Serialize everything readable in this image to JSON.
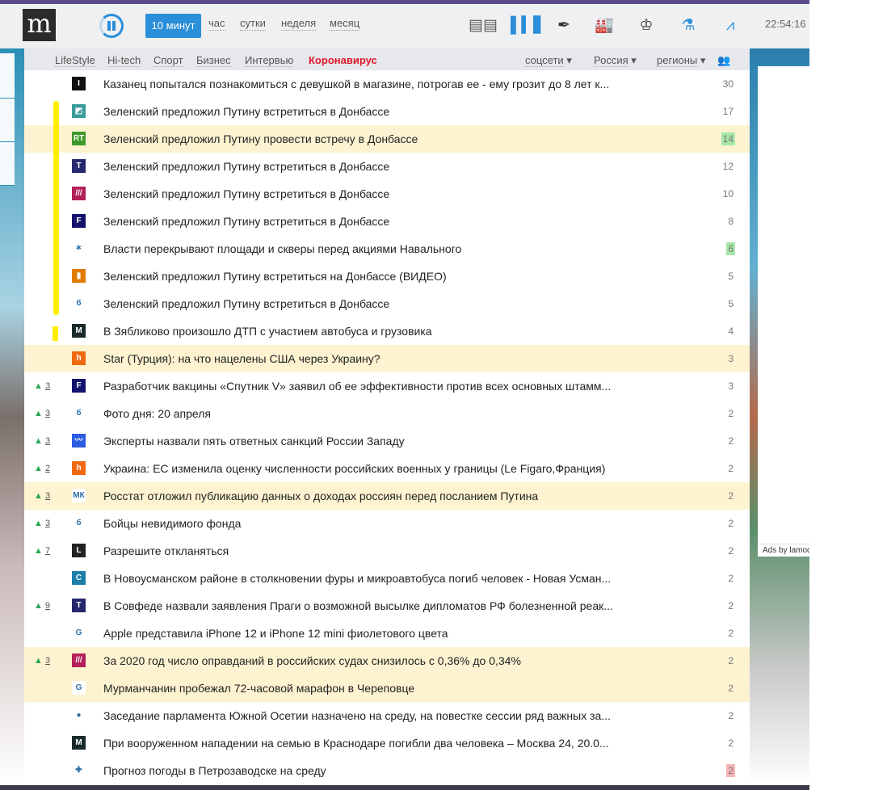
{
  "header": {
    "logo": "m",
    "periods": [
      "10 минут",
      "час",
      "сутки",
      "неделя",
      "месяц"
    ],
    "icons": [
      "columns-icon",
      "bar-chart-icon",
      "pen-icon",
      "factory-icon",
      "crown-icon",
      "flask-icon",
      "trend-icon"
    ],
    "clock": "22:54:16"
  },
  "subnav": {
    "categories": [
      "LifeStyle",
      "Hi-tech",
      "Спорт",
      "Бизнес",
      "Интервью",
      "Коронавирус"
    ],
    "dropdowns": [
      "соцсети",
      "Россия",
      "регионы"
    ]
  },
  "ads": {
    "label": "Ads by lamoda"
  },
  "colors": {
    "accent": "#2a8ed8",
    "highlight": "#fdf3d1",
    "positive": "#a8e6a8",
    "negative": "#f6b3b3",
    "topline": "#5b4a8e"
  },
  "rows": [
    {
      "delta": "",
      "src": "I",
      "srcbg": "#111",
      "title": "Казанец попытался познакомиться с девушкой в магазине, потрогав ее - ему грозит до 8 лет к...",
      "count": "30",
      "hl": false,
      "badge": ""
    },
    {
      "delta": "",
      "src": "◩",
      "srcbg": "#3a9a9a",
      "title": "Зеленский предложил Путину встретиться в Донбассе",
      "count": "17",
      "hl": false,
      "badge": ""
    },
    {
      "delta": "",
      "src": "RT",
      "srcbg": "#3e9a2c",
      "title": "Зеленский предложил Путину провести встречу в Донбассе",
      "count": "14",
      "hl": true,
      "badge": "g"
    },
    {
      "delta": "",
      "src": "T",
      "srcbg": "#26286e",
      "title": "Зеленский предложил Путину встретиться в Донбассе",
      "count": "12",
      "hl": false,
      "badge": ""
    },
    {
      "delta": "",
      "src": "///",
      "srcbg": "#b3205a",
      "title": "Зеленский предложил Путину встретиться в Донбассе",
      "count": "10",
      "hl": false,
      "badge": ""
    },
    {
      "delta": "",
      "src": "F",
      "srcbg": "#13136e",
      "title": "Зеленский предложил Путину встретиться в Донбассе",
      "count": "8",
      "hl": false,
      "badge": ""
    },
    {
      "delta": "",
      "src": "✶",
      "srcbg": "#fff",
      "title": "Власти перекрывают площади и скверы перед акциями Навального",
      "count": "6",
      "hl": false,
      "badge": "g"
    },
    {
      "delta": "",
      "src": "▮",
      "srcbg": "#e07b00",
      "title": "Зеленский предложил Путину встретиться на Донбассе (ВИДЕО)",
      "count": "5",
      "hl": false,
      "badge": ""
    },
    {
      "delta": "",
      "src": "б",
      "srcbg": "#fff",
      "title": "Зеленский предложил Путину встретиться в Донбассе",
      "count": "5",
      "hl": false,
      "badge": ""
    },
    {
      "delta": "",
      "src": "M",
      "srcbg": "#1a2a2a",
      "title": "В Зябликово произошло ДТП с участием автобуса и грузовика",
      "count": "4",
      "hl": false,
      "badge": ""
    },
    {
      "delta": "",
      "src": "h",
      "srcbg": "#f06a10",
      "title": "Star (Турция): на что нацелены США через Украину?",
      "count": "3",
      "hl": true,
      "badge": ""
    },
    {
      "delta": "3",
      "src": "F",
      "srcbg": "#13136e",
      "title": "Разработчик вакцины «Спутник V» заявил об ее эффективности против всех основных штамм...",
      "count": "3",
      "hl": false,
      "badge": ""
    },
    {
      "delta": "3",
      "src": "б",
      "srcbg": "#fff",
      "title": "Фото дня: 20 апреля",
      "count": "2",
      "hl": false,
      "badge": ""
    },
    {
      "delta": "3",
      "src": "〰",
      "srcbg": "#2a5ce0",
      "title": "Эксперты назвали пять ответных санкций России Западу",
      "count": "2",
      "hl": false,
      "badge": ""
    },
    {
      "delta": "2",
      "src": "h",
      "srcbg": "#f06a10",
      "title": "Украина: ЕС изменила оценку численности российских военных у границы (Le Figaro,Франция)",
      "count": "2",
      "hl": false,
      "badge": ""
    },
    {
      "delta": "3",
      "src": "МК",
      "srcbg": "#fff",
      "title": "Росстат отложил публикацию данных о доходах россиян перед посланием Путина",
      "count": "2",
      "hl": true,
      "badge": ""
    },
    {
      "delta": "3",
      "src": "б",
      "srcbg": "#fff",
      "title": "Бойцы невидимого фонда",
      "count": "2",
      "hl": false,
      "badge": ""
    },
    {
      "delta": "7",
      "src": "L",
      "srcbg": "#222",
      "title": "Разрешите откланяться",
      "count": "2",
      "hl": false,
      "badge": ""
    },
    {
      "delta": "",
      "src": "C",
      "srcbg": "#1c7fa8",
      "title": "В Новоусманском районе в столкновении фуры и микроавтобуса погиб человек - Новая Усман...",
      "count": "2",
      "hl": false,
      "badge": ""
    },
    {
      "delta": "9",
      "src": "T",
      "srcbg": "#26286e",
      "title": "В Совфеде назвали заявления Праги о возможной высылке дипломатов РФ болезненной реак...",
      "count": "2",
      "hl": false,
      "badge": ""
    },
    {
      "delta": "",
      "src": "G",
      "srcbg": "#fff",
      "title": "Apple представила iPhone 12 и iPhone 12 mini фиолетового цвета",
      "count": "2",
      "hl": false,
      "badge": ""
    },
    {
      "delta": "3",
      "src": "///",
      "srcbg": "#b3205a",
      "title": "За 2020 год число оправданий в российских судах снизилось с 0,36% до 0,34%",
      "count": "2",
      "hl": true,
      "badge": ""
    },
    {
      "delta": "",
      "src": "G",
      "srcbg": "#fff",
      "title": "Мурманчанин пробежал 72-часовой марафон в Череповце",
      "count": "2",
      "hl": true,
      "badge": ""
    },
    {
      "delta": "",
      "src": "●",
      "srcbg": "#fff",
      "title": "Заседание парламента Южной Осетии назначено на среду, на повестке сессии ряд важных за...",
      "count": "2",
      "hl": false,
      "badge": ""
    },
    {
      "delta": "",
      "src": "M",
      "srcbg": "#1a2a2a",
      "title": "При вооруженном нападении на семью в Краснодаре погибли два человека – Москва 24, 20.0...",
      "count": "2",
      "hl": false,
      "badge": ""
    },
    {
      "delta": "",
      "src": "✚",
      "srcbg": "#fff",
      "title": "Прогноз погоды в Петрозаводске на среду",
      "count": "2",
      "hl": false,
      "badge": "r"
    }
  ]
}
